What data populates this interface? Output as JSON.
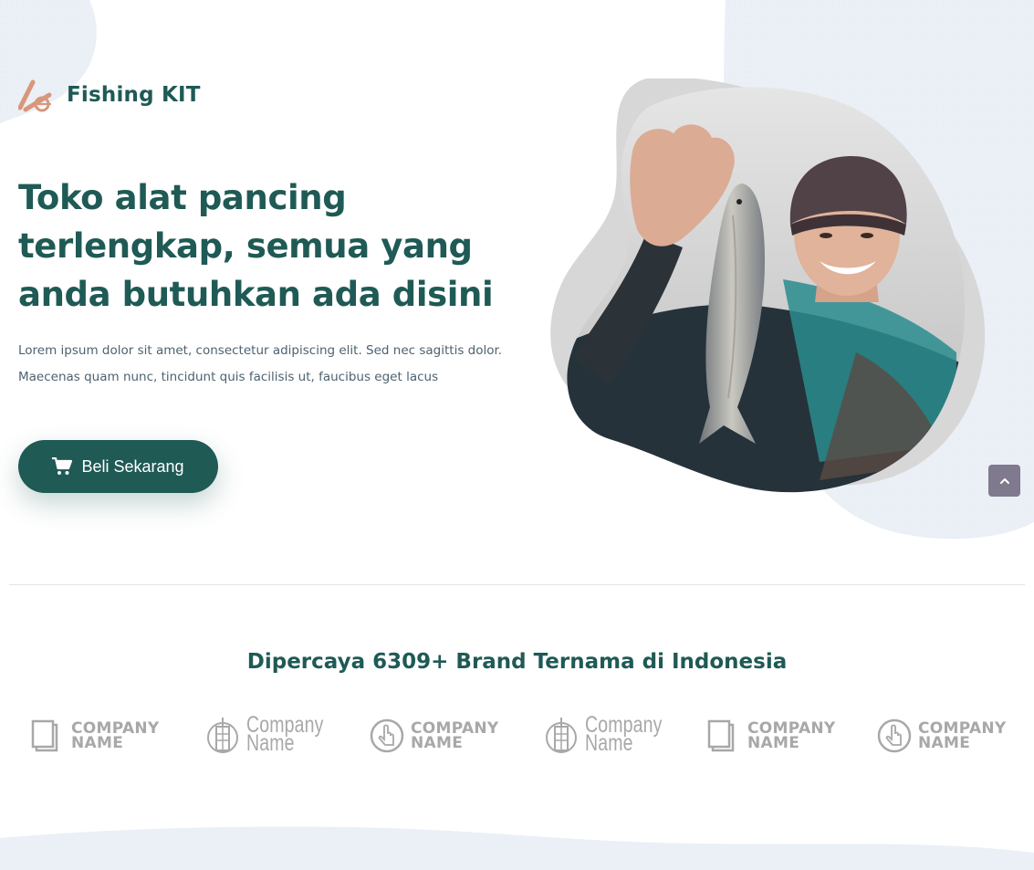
{
  "header": {
    "brand_name": "Fishing KIT",
    "logo_icon": "fishing-rod-icon"
  },
  "hero": {
    "title": "Toko alat pancing terlengkap, semua yang anda butuhkan ada disini",
    "description": "Lorem ipsum dolor sit amet, consectetur adipiscing elit. Sed nec sagittis dolor. Maecenas quam nunc, tincidunt quis facilisis ut, faucibus eget lacus",
    "cta_label": "Beli Sekarang",
    "cta_icon": "cart-icon"
  },
  "trust": {
    "title": "Dipercaya 6309+ Brand Ternama di Indonesia",
    "logos": [
      {
        "line1": "COMPANY",
        "line2": "NAME",
        "icon": "pages-icon"
      },
      {
        "line1": "Company",
        "line2": "Name",
        "icon": "building-icon"
      },
      {
        "line1": "COMPANY",
        "line2": "NAME",
        "icon": "pointer-icon"
      },
      {
        "line1": "Company",
        "line2": "Name",
        "icon": "building-icon"
      },
      {
        "line1": "COMPANY",
        "line2": "NAME",
        "icon": "pages-icon"
      },
      {
        "line1": "COMPANY",
        "line2": "NAME",
        "icon": "pointer-icon"
      }
    ]
  },
  "colors": {
    "primary": "#1f5a55",
    "accent": "#d9967a",
    "background_blob": "#eaf0f6",
    "scroll_button": "#7f7a8e",
    "logo_gray": "#a8a8a8"
  }
}
